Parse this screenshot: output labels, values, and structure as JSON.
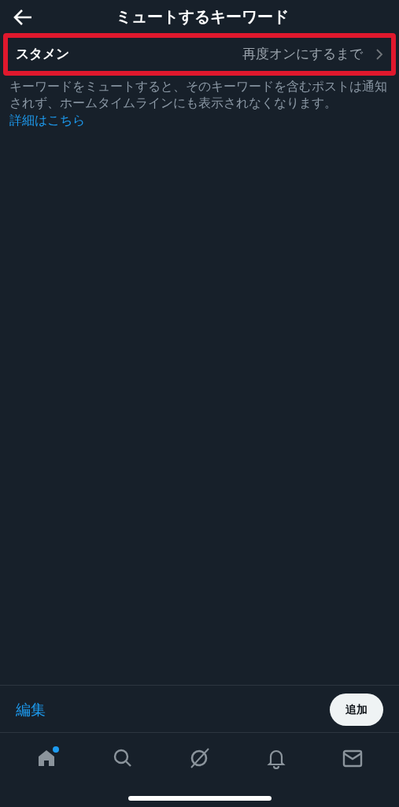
{
  "header": {
    "title": "ミュートするキーワード"
  },
  "keywords": [
    {
      "word": "スタメン",
      "duration": "再度オンにするまで",
      "highlighted": true
    }
  ],
  "description": {
    "text": "キーワードをミュートすると、そのキーワードを含むポストは通知されず、ホームタイムラインにも表示されなくなります。",
    "link": "詳細はこちら"
  },
  "footer": {
    "edit": "編集",
    "add": "追加"
  },
  "tab_bar": [
    {
      "kind": "home",
      "badge": true
    },
    {
      "kind": "search",
      "badge": false
    },
    {
      "kind": "grok",
      "badge": false
    },
    {
      "kind": "notifications",
      "badge": false
    },
    {
      "kind": "messages",
      "badge": false
    }
  ]
}
